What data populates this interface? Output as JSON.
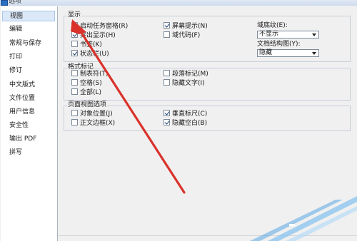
{
  "window": {
    "title": "选项"
  },
  "sidebar": {
    "items": [
      {
        "label": "视图",
        "selected": true
      },
      {
        "label": "编辑"
      },
      {
        "label": "常规与保存"
      },
      {
        "label": "打印"
      },
      {
        "label": "修订"
      },
      {
        "label": "中文版式"
      },
      {
        "label": "文件位置"
      },
      {
        "label": "用户信息"
      },
      {
        "label": "安全性"
      },
      {
        "label": "输出 PDF"
      },
      {
        "label": "拼写"
      }
    ]
  },
  "display": {
    "title": "显示",
    "options": [
      {
        "label": "启动任务窗格(R)",
        "checked": true
      },
      {
        "label": "突出显示(H)",
        "checked": true
      },
      {
        "label": "书签(K)",
        "checked": false
      },
      {
        "label": "状态栏(U)",
        "checked": true
      },
      {
        "label": "屏幕提示(N)",
        "checked": true
      },
      {
        "label": "域代码(F)",
        "checked": false
      }
    ],
    "field_shading": {
      "label": "域底纹(E):",
      "value": "不显示"
    },
    "doc_map": {
      "label": "文档结构图(Y):",
      "value": "隐藏"
    }
  },
  "format_marks": {
    "title": "格式标记",
    "options": [
      {
        "label": "制表符(T)",
        "checked": false
      },
      {
        "label": "空格(S)",
        "checked": false
      },
      {
        "label": "全部(L)",
        "checked": false
      },
      {
        "label": "段落标记(M)",
        "checked": false
      },
      {
        "label": "隐藏文字(I)",
        "checked": false
      }
    ]
  },
  "page_view": {
    "title": "页面视图选项",
    "options": [
      {
        "label": "对象位置(J)",
        "checked": false
      },
      {
        "label": "正文边框(X)",
        "checked": false
      },
      {
        "label": "垂直标尺(C)",
        "checked": true
      },
      {
        "label": "隐藏空白(B)",
        "checked": true
      }
    ]
  },
  "colors": {
    "annotation_arrow": "#d9322b",
    "selection": "#dbe8f7"
  }
}
